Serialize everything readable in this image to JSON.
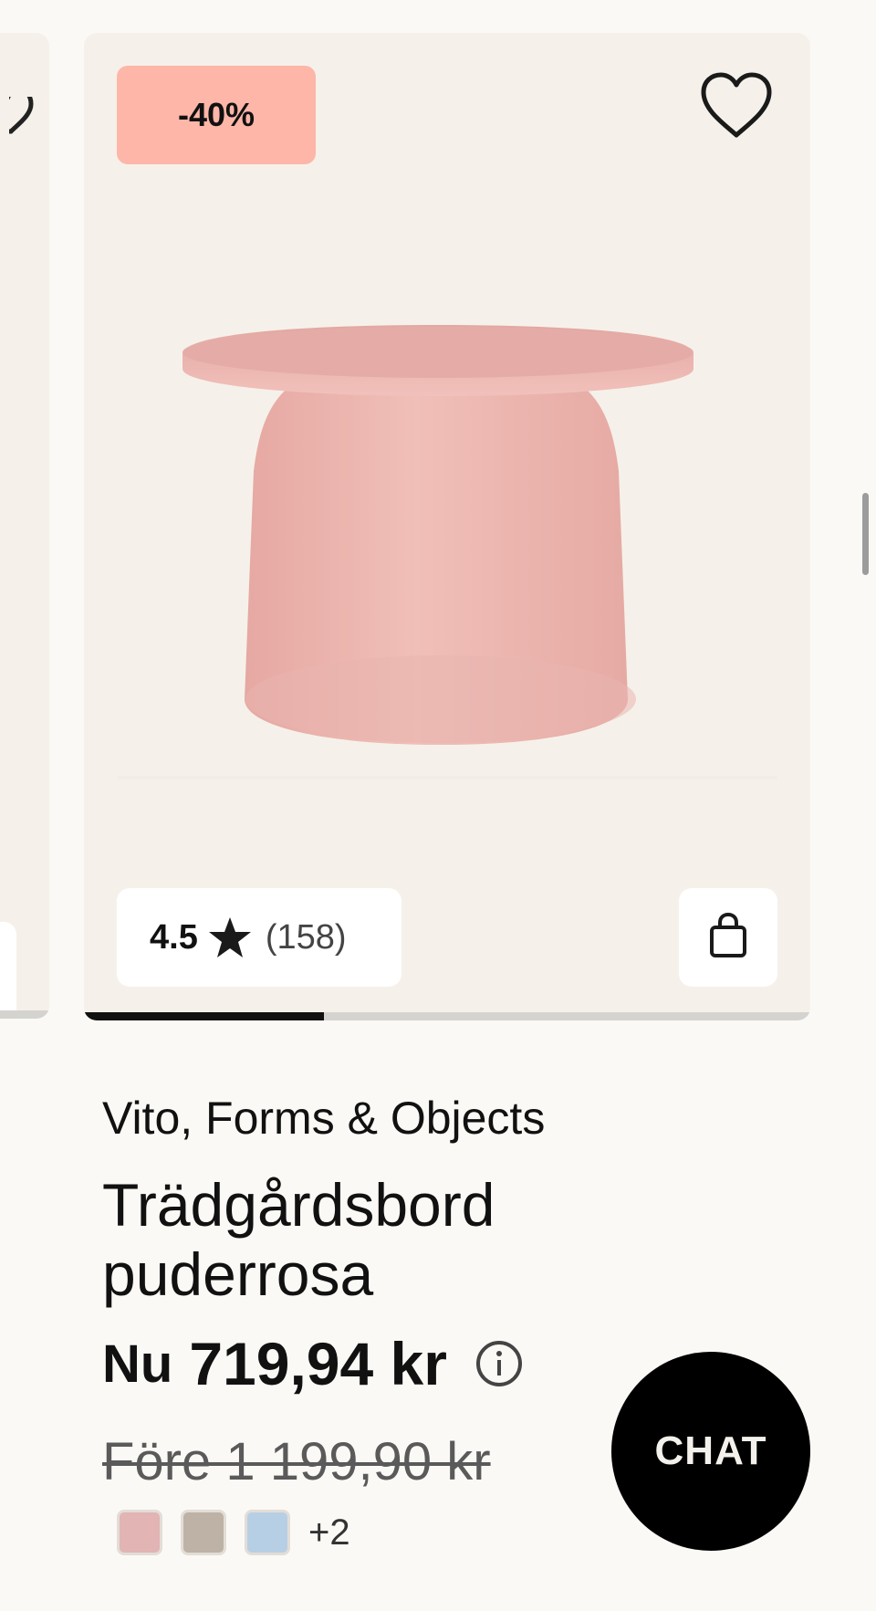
{
  "card": {
    "discount_label": "-40%",
    "rating_value": "4.5",
    "rating_count": "(158)",
    "image_progress": 0.33,
    "product_color": "#efb8b0"
  },
  "product": {
    "brand": "Vito, Forms & Objects",
    "title_line1": "Trädgårdsbord",
    "title_line2": "puderrosa",
    "price_prefix": "Nu",
    "price_current": "719,94 kr",
    "price_before": "Före 1 199,90 kr",
    "swatches": [
      "#e2b4b4",
      "#bdb2a5",
      "#b7cfe4"
    ],
    "more_colors": "+2"
  },
  "chat": {
    "label": "CHAT"
  },
  "colors": {
    "card_background": "#f5f1ea",
    "discount_badge": "#fdb6a8",
    "page_background": "#fbf9f5"
  }
}
